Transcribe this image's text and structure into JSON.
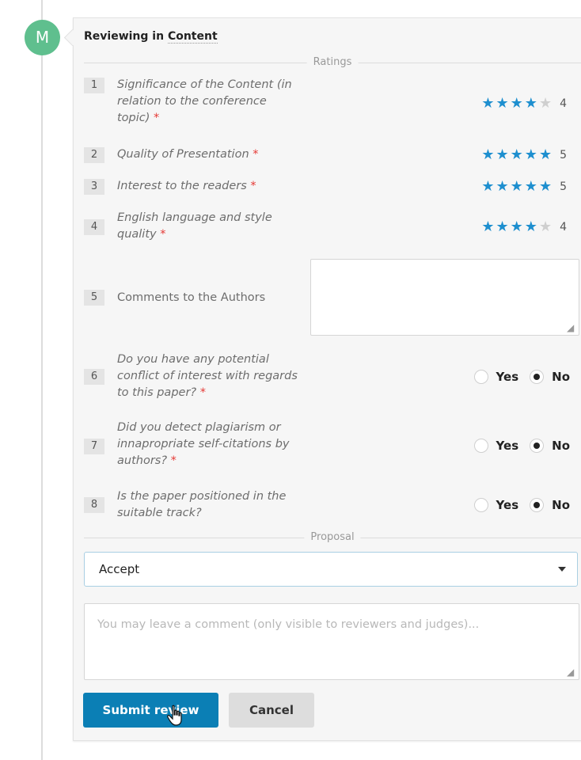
{
  "avatar": {
    "initial": "M",
    "color": "#5fbf8e"
  },
  "header": {
    "prefix": "Reviewing in",
    "context": "Content"
  },
  "sections": {
    "ratings": "Ratings",
    "proposal": "Proposal"
  },
  "accent_color": "#1e8fcf",
  "questions": [
    {
      "num": "1",
      "text": "Significance of the Content (in relation to the conference topic)",
      "required": "*",
      "rating": 4,
      "rating_label": "4"
    },
    {
      "num": "2",
      "text": "Quality of Presentation",
      "required": "*",
      "rating": 5,
      "rating_label": "5"
    },
    {
      "num": "3",
      "text": "Interest to the readers",
      "required": "*",
      "rating": 5,
      "rating_label": "5"
    },
    {
      "num": "4",
      "text": "English language and style quality",
      "required": "*",
      "rating": 4,
      "rating_label": "4"
    },
    {
      "num": "5",
      "text": "Comments to the Authors",
      "value": ""
    },
    {
      "num": "6",
      "text": "Do you have any potential conflict of interest with regards to this paper?",
      "required": "*",
      "options": [
        "Yes",
        "No"
      ],
      "selected": "No"
    },
    {
      "num": "7",
      "text": "Did you detect plagiarism or innapropriate self-citations by authors?",
      "required": "*",
      "options": [
        "Yes",
        "No"
      ],
      "selected": "No"
    },
    {
      "num": "8",
      "text": "Is the paper positioned in the suitable track?",
      "options": [
        "Yes",
        "No"
      ],
      "selected": "No"
    }
  ],
  "proposal": {
    "selected": "Accept",
    "comment_placeholder": "You may leave a comment (only visible to reviewers and judges)...",
    "comment_value": ""
  },
  "buttons": {
    "submit": "Submit review",
    "cancel": "Cancel"
  }
}
